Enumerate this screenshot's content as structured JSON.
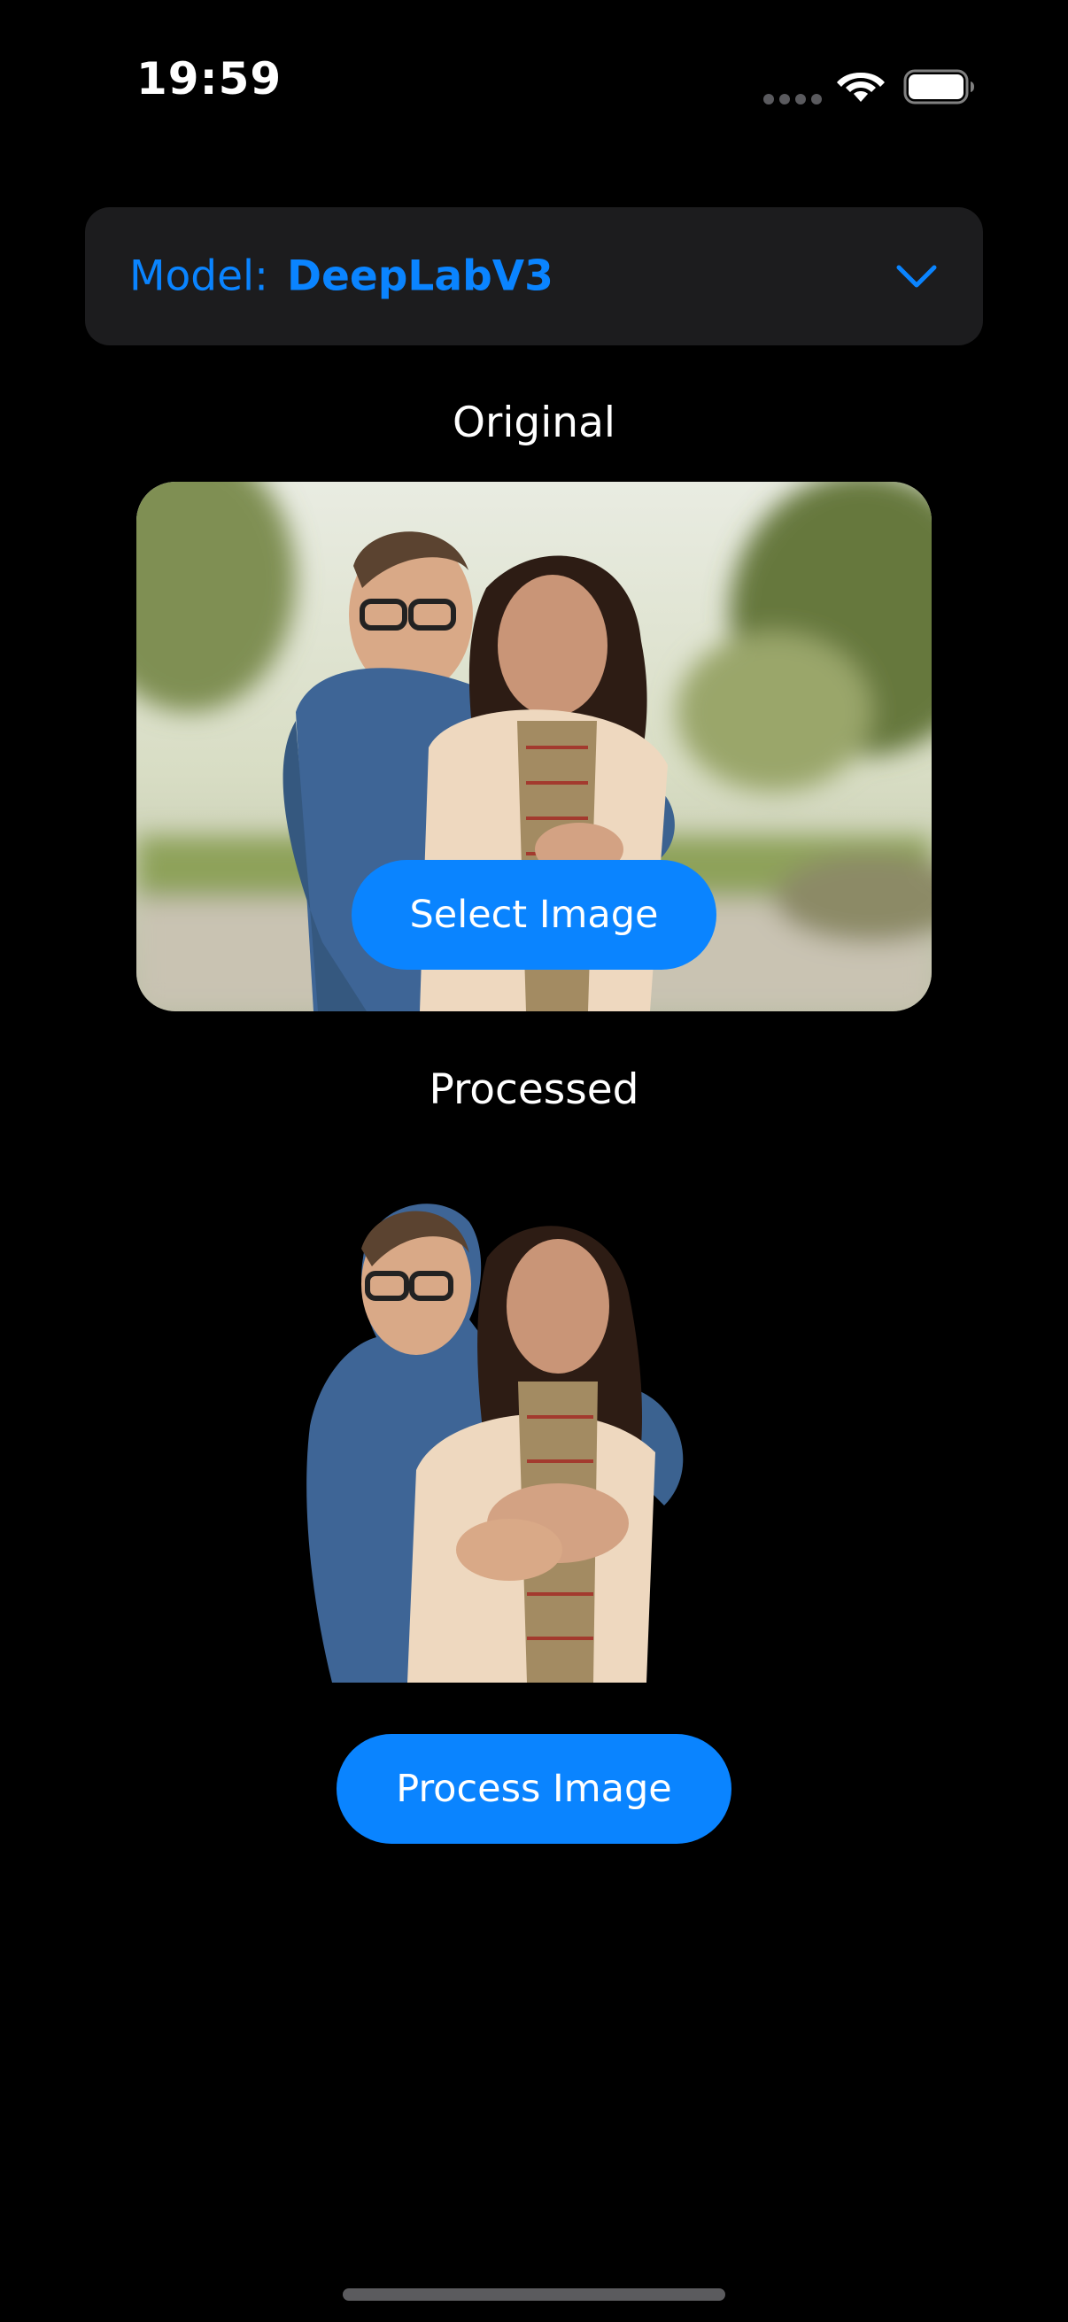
{
  "status_bar": {
    "time": "19:59",
    "icons": [
      "signal-dots-icon",
      "wifi-icon",
      "battery-icon"
    ]
  },
  "model_selector": {
    "label": "Model:",
    "value": "DeepLabV3",
    "icon": "chevron-down-icon"
  },
  "original": {
    "title": "Original",
    "select_button_label": "Select Image"
  },
  "processed": {
    "title": "Processed",
    "process_button_label": "Process Image"
  },
  "colors": {
    "accent": "#0a84ff",
    "background": "#000000",
    "card": "#1c1c1e"
  }
}
